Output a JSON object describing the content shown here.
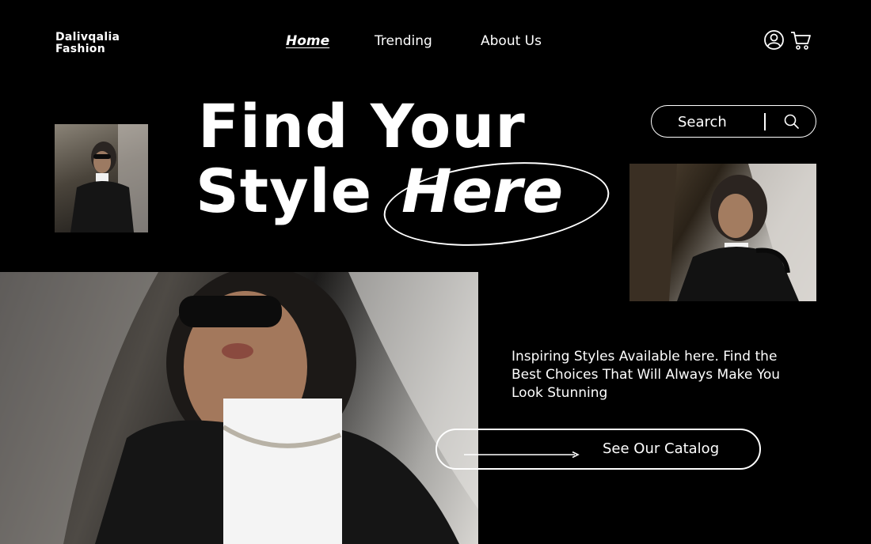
{
  "brand": {
    "line1": "Dalivqalia",
    "line2": "Fashion"
  },
  "nav": {
    "items": [
      {
        "label": "Home",
        "active": true
      },
      {
        "label": "Trending",
        "active": false
      },
      {
        "label": "About Us",
        "active": false
      }
    ]
  },
  "header_icons": [
    "user-icon",
    "cart-icon"
  ],
  "hero": {
    "line1": "Find Your",
    "line2": "Style",
    "emphasis": "Here"
  },
  "search": {
    "label": "Search",
    "icon": "search-icon"
  },
  "tagline": "Inspiring Styles Available here. Find the Best Choices That Will Always Make You Look Stunning",
  "cta": {
    "label": "See Our Catalog",
    "icon": "arrow-right-icon"
  },
  "colors": {
    "background": "#000000",
    "foreground": "#ffffff"
  }
}
